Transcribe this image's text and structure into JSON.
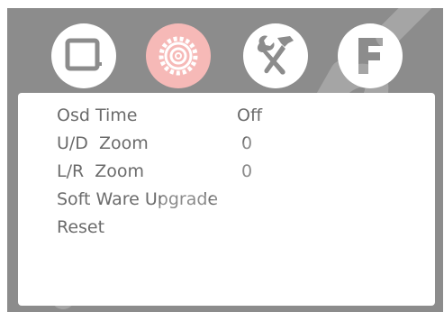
{
  "tabs": [
    {
      "icon": "picture-icon",
      "active": false
    },
    {
      "icon": "gear-icon",
      "active": true
    },
    {
      "icon": "tools-icon",
      "active": false
    },
    {
      "icon": "f-letter-icon",
      "letter": "F",
      "active": false
    }
  ],
  "menu": {
    "items": [
      {
        "label": "Osd Time",
        "value": "Off"
      },
      {
        "label": "U/D  Zoom",
        "value": "0"
      },
      {
        "label": "L/R  Zoom",
        "value": "0"
      },
      {
        "label": "Soft Ware Upgrade",
        "value": ""
      },
      {
        "label": "Reset",
        "value": ""
      }
    ]
  },
  "colors": {
    "background": "#8c8c8c",
    "active_tab": "#f6b9b7",
    "icon": "#8c8c8c",
    "text": "#6b6b6b"
  }
}
